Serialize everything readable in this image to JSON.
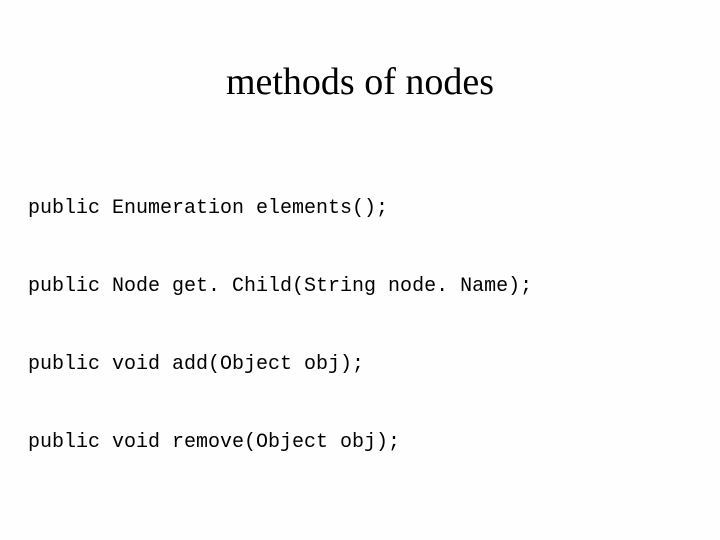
{
  "title": "methods of nodes",
  "code": {
    "lines": [
      "public Enumeration elements();",
      "public Node get. Child(String node. Name);",
      "public void add(Object obj);",
      "public void remove(Object obj);"
    ]
  }
}
